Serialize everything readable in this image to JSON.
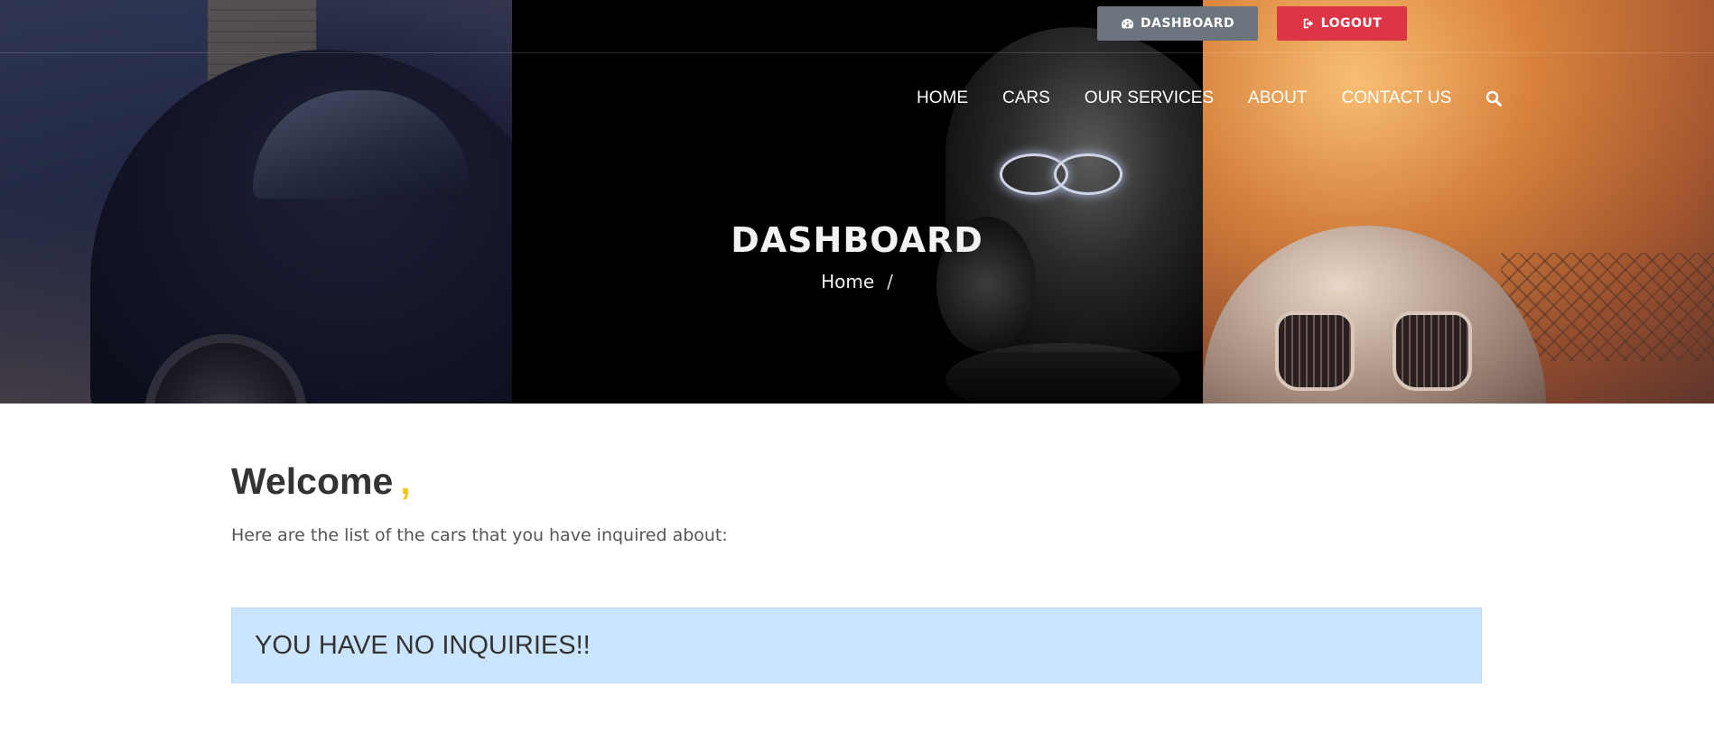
{
  "topbar": {
    "dashboard_label": "DASHBOARD",
    "logout_label": "LOGOUT",
    "dashboard_color": "#6c757d",
    "logout_color": "#dc3545"
  },
  "nav": {
    "items": [
      "HOME",
      "CARS",
      "OUR SERVICES",
      "ABOUT",
      "CONTACT US"
    ],
    "search_icon": "search-icon"
  },
  "hero": {
    "title": "DASHBOARD",
    "breadcrumb_home": "Home",
    "breadcrumb_sep": "/"
  },
  "content": {
    "welcome": "Welcome",
    "welcome_comma": ",",
    "subtext": "Here are the list of the cars that you have inquired about:",
    "alert": "YOU HAVE NO INQUIRIES!!",
    "accent_color": "#f5c518",
    "alert_bg": "#cce5ff"
  }
}
